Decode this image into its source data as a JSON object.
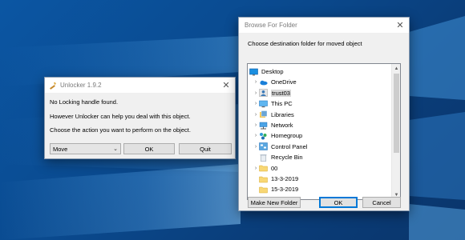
{
  "unlocker": {
    "title": "Unlocker 1.9.2",
    "close_glyph": "✕",
    "messages": [
      "No Locking handle found.",
      "However Unlocker can help you deal with this object.",
      "Choose the action you want to perform on the object."
    ],
    "action_select": {
      "value": "Move"
    },
    "ok_label": "OK",
    "quit_label": "Quit"
  },
  "browse": {
    "title": "Browse For Folder",
    "close_glyph": "✕",
    "prompt": "Choose destination folder for moved object",
    "tree": [
      {
        "label": "Desktop",
        "icon": "desktop-icon",
        "expander": "",
        "indent": 0,
        "selected": false
      },
      {
        "label": "OneDrive",
        "icon": "onedrive-icon",
        "expander": "›",
        "indent": 1,
        "selected": false
      },
      {
        "label": "trust03",
        "icon": "user-folder-icon",
        "expander": "›",
        "indent": 1,
        "selected": true
      },
      {
        "label": "This PC",
        "icon": "this-pc-icon",
        "expander": "›",
        "indent": 1,
        "selected": false
      },
      {
        "label": "Libraries",
        "icon": "libraries-icon",
        "expander": "›",
        "indent": 1,
        "selected": false
      },
      {
        "label": "Network",
        "icon": "network-icon",
        "expander": "›",
        "indent": 1,
        "selected": false
      },
      {
        "label": "Homegroup",
        "icon": "homegroup-icon",
        "expander": "›",
        "indent": 1,
        "selected": false
      },
      {
        "label": "Control Panel",
        "icon": "control-panel-icon",
        "expander": "›",
        "indent": 1,
        "selected": false
      },
      {
        "label": "Recycle Bin",
        "icon": "recycle-bin-icon",
        "expander": "",
        "indent": 1,
        "selected": false
      },
      {
        "label": "00",
        "icon": "folder-icon",
        "expander": "›",
        "indent": 1,
        "selected": false
      },
      {
        "label": "13-3-2019",
        "icon": "folder-icon",
        "expander": "",
        "indent": 1,
        "selected": false
      },
      {
        "label": "15-3-2019",
        "icon": "folder-icon",
        "expander": "",
        "indent": 1,
        "selected": false
      }
    ],
    "make_new_folder_label": "Make New Folder",
    "ok_label": "OK",
    "cancel_label": "Cancel"
  },
  "colors": {
    "desktop_bg": "#0a4a8f",
    "window_bg": "#f0f0f0",
    "accent": "#0078d7",
    "folder_yellow": "#f8d775"
  }
}
